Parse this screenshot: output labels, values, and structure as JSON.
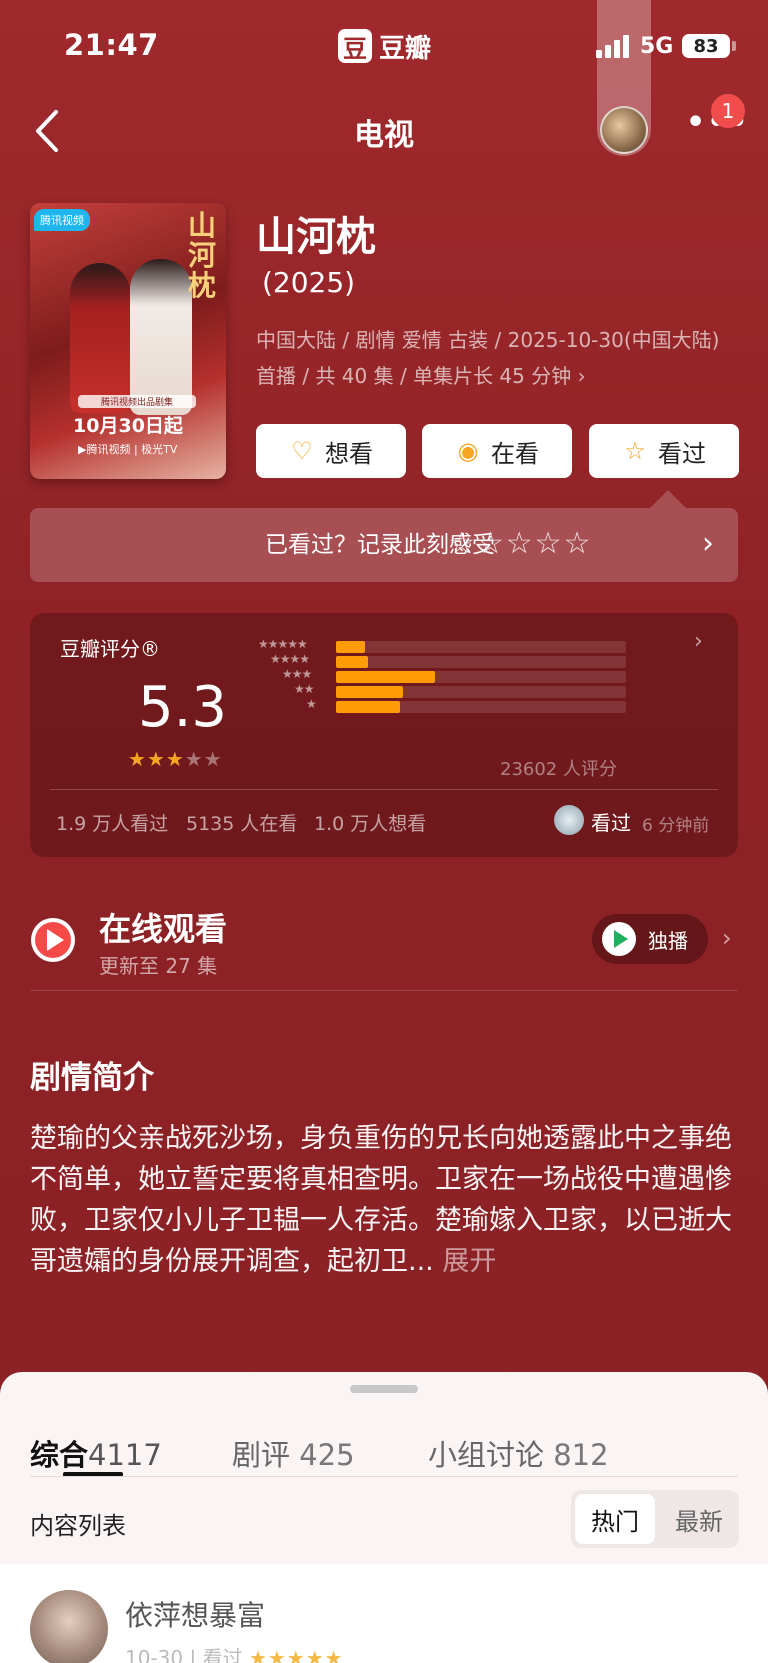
{
  "status_bar": {
    "time": "21:47",
    "app_logo_char": "豆",
    "app_name": "豆瓣",
    "network": "5G",
    "battery": "83"
  },
  "nav": {
    "title": "电视",
    "notification_count": "1",
    "more_label": "•••"
  },
  "show": {
    "title": "山河枕",
    "year": "(2025)",
    "meta": "中国大陆 / 剧情 爱情 古装 / 2025-10-30(中国大陆) 首播 / 共 40 集 / 单集片长 45 分钟 ›",
    "poster": {
      "badge": "腾讯视频",
      "title": "山河枕",
      "subtitle": "腾讯视频出品剧集",
      "date": "10月30日起",
      "footer": "▶腾讯视频 | 极光TV"
    }
  },
  "actions": [
    {
      "label": "想看",
      "icon": "heart-plus-icon",
      "glyph": "♡"
    },
    {
      "label": "在看",
      "icon": "watching-icon",
      "glyph": "◉"
    },
    {
      "label": "看过",
      "icon": "star-icon",
      "glyph": "☆"
    }
  ],
  "record": {
    "text": "已看过？记录此刻感受",
    "stars": "☆☆☆☆☆",
    "chevron": "›"
  },
  "rating": {
    "label": "豆瓣评分®",
    "score": "5.3",
    "stars_display": 2.5,
    "distribution": [
      {
        "stars": "★★★★★",
        "fraction": 0.1
      },
      {
        "stars": "★★★★",
        "fraction": 0.11
      },
      {
        "stars": "★★★",
        "fraction": 0.34
      },
      {
        "stars": "★★",
        "fraction": 0.23
      },
      {
        "stars": "★",
        "fraction": 0.22
      }
    ],
    "count": "23602 人评分",
    "stats": [
      "1.9 万人看过",
      "5135 人在看",
      "1.0 万人想看"
    ],
    "friend_status": "看过",
    "friend_time": "6 分钟前"
  },
  "watch": {
    "title": "在线观看",
    "subtitle": "更新至 27 集",
    "platform_label": "独播"
  },
  "synopsis": {
    "title": "剧情简介",
    "text": "楚瑜的父亲战死沙场，身负重伤的兄长向她透露此中之事绝不简单，她立誓定要将真相查明。卫家在一场战役中遭遇惨败，卫家仅小儿子卫韫一人存活。楚瑜嫁入卫家，以已逝大哥遗孀的身份展开调查，起初卫...",
    "more": "展开"
  },
  "sheet": {
    "tabs": [
      {
        "label": "综合",
        "count": "4117"
      },
      {
        "label": "剧评",
        "count": "425"
      },
      {
        "label": "小组讨论",
        "count": "812"
      }
    ],
    "list_label": "内容列表",
    "sort_options": [
      "热门",
      "最新"
    ],
    "post": {
      "author": "依萍想暴富",
      "date": "10-30",
      "status": "看过",
      "stars": "★★★★★"
    }
  },
  "colors": {
    "background": "#8f2327",
    "accent": "#f5a623",
    "bar": "#ff9c07",
    "play": "#f64a49"
  }
}
